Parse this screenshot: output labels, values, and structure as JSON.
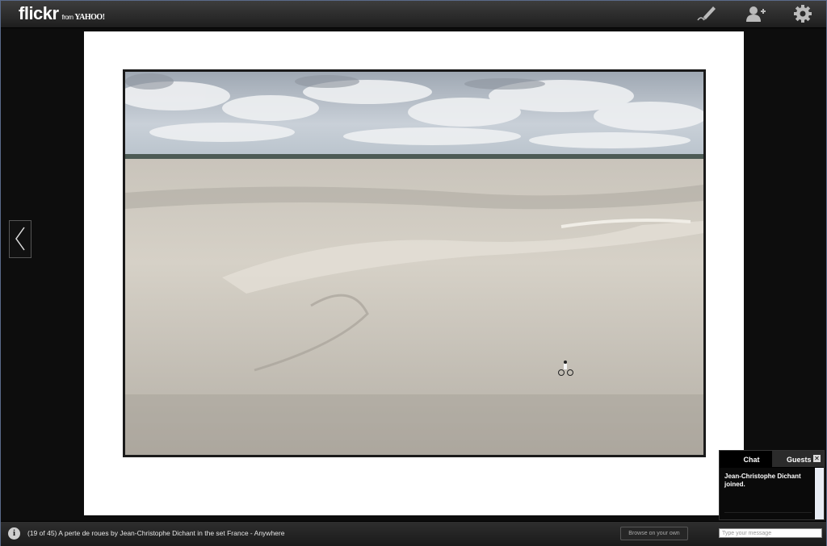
{
  "header": {
    "logo_text": "flickr",
    "logo_from": "from",
    "logo_brand": "YAHOO!",
    "icons": [
      "edit-pen-icon",
      "add-contact-icon",
      "gear-icon"
    ]
  },
  "viewer": {
    "prev_icon": "chevron-left-icon",
    "background": "#0d0d0d",
    "frame_background": "#ffffff"
  },
  "chat": {
    "tab_chat": "Chat",
    "tab_guests": "Guests",
    "close_symbol": "✕",
    "message": "Jean-Christophe Dichant joined."
  },
  "footer": {
    "info_symbol": "i",
    "caption": "(19 of 45) A perte de roues by Jean-Christophe Dichant in the set France - Anywhere",
    "browse_label": "Browse on your own",
    "chat_placeholder": "Type your message"
  }
}
